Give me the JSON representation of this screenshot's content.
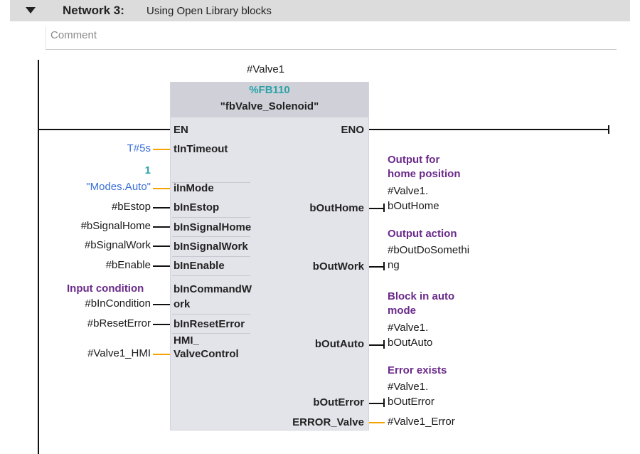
{
  "network": {
    "title": "Network 3:",
    "subtitle": "Using Open Library blocks",
    "comment_placeholder": "Comment"
  },
  "block": {
    "instance": "#Valve1",
    "number": "%FB110",
    "name": "\"fbValve_Solenoid\""
  },
  "pins": {
    "en": "EN",
    "eno": "ENO",
    "inputs": {
      "tInTimeout": "tInTimeout",
      "iInMode": "iInMode",
      "bInEstop": "bInEstop",
      "bInSignalHome": "bInSignalHome",
      "bInSignalWork": "bInSignalWork",
      "bInEnable": "bInEnable",
      "bInCommand_1": "bInCommandW",
      "bInCommand_2": "ork",
      "bInResetError": "bInResetError",
      "hmi_1": "HMI_",
      "hmi_2": "ValveControl"
    },
    "outputs": {
      "bOutHome": "bOutHome",
      "bOutWork": "bOutWork",
      "bOutAuto": "bOutAuto",
      "bOutError": "bOutError",
      "error_valve": "ERROR_Valve"
    }
  },
  "input_values": {
    "timeout": "T#5s",
    "mode_const": "1",
    "mode_tag": "\"Modes.Auto\"",
    "estop": "#bEstop",
    "signal_home": "#bSignalHome",
    "signal_work": "#bSignalWork",
    "enable": "#bEnable",
    "condition": "#bInCondition",
    "reset_error": "#bResetError",
    "hmi": "#Valve1_HMI"
  },
  "input_comments": {
    "condition": "Input condition"
  },
  "output_values": {
    "home_1": "#Valve1.",
    "home_2": "bOutHome",
    "work_1": "#bOutDoSomethi",
    "work_2": "ng",
    "auto_1": "#Valve1.",
    "auto_2": "bOutAuto",
    "error_1": "#Valve1.",
    "error_2": "bOutError",
    "error_valve": "#Valve1_Error"
  },
  "output_comments": {
    "home_1": "Output for",
    "home_2": "home position",
    "work": "Output action",
    "auto_1": "Block in auto",
    "auto_2": "mode",
    "error": "Error exists"
  },
  "colors": {
    "header_bg": "#dcdcdc",
    "block_bg": "#e3e3ea",
    "block_head_bg": "#cfd0d8",
    "fb_number": "#2aa3a8",
    "comment_text": "#6a2a8a",
    "wire": "#111111",
    "orange_wire": "#f5a300",
    "const_blue": "#2aa3a8",
    "tag_blue": "#3a6fd8"
  }
}
